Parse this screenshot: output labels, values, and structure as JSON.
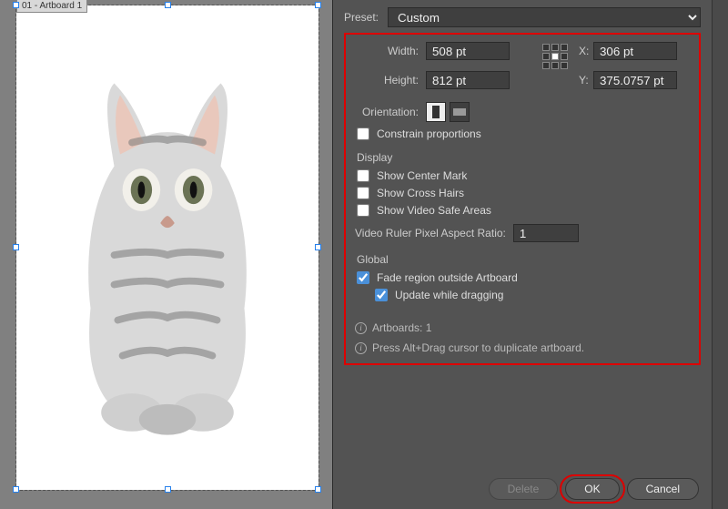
{
  "canvas": {
    "artboard_label": "01 - Artboard 1"
  },
  "preset": {
    "label": "Preset:",
    "value": "Custom"
  },
  "dims": {
    "width_label": "Width:",
    "width_value": "508 pt",
    "height_label": "Height:",
    "height_value": "812 pt",
    "x_label": "X:",
    "x_value": "306 pt",
    "y_label": "Y:",
    "y_value": "375.0757 pt",
    "orientation_label": "Orientation:",
    "constrain_label": "Constrain proportions"
  },
  "display": {
    "header": "Display",
    "center_mark": "Show Center Mark",
    "cross_hairs": "Show Cross Hairs",
    "safe_areas": "Show Video Safe Areas",
    "aspect_label": "Video Ruler Pixel Aspect Ratio:",
    "aspect_value": "1"
  },
  "global": {
    "header": "Global",
    "fade": "Fade region outside Artboard",
    "update": "Update while dragging"
  },
  "info": {
    "artboards": "Artboards: 1",
    "hint": "Press Alt+Drag cursor to duplicate artboard."
  },
  "buttons": {
    "delete": "Delete",
    "ok": "OK",
    "cancel": "Cancel"
  }
}
